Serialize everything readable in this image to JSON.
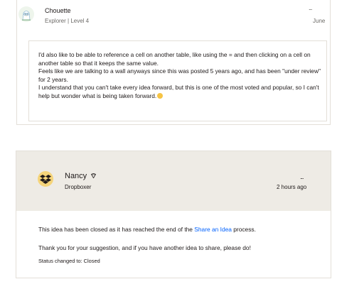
{
  "top_post": {
    "author": "Chouette",
    "rank": "Explorer | Level 4",
    "date": "June",
    "menu": "...",
    "paragraphs": [
      "I'd also like to be able to reference a cell on another table, like using the = and then clicking on a cell on another table so that it keeps the same value.",
      "Feels like we are talking to a wall anyways since this was posted 5 years ago, and has been \"under review\" for 2 years.",
      "I understand that you can't take every idea forward, but this is one of the most voted and popular, so I can't help but wonder what is being taken forward."
    ]
  },
  "staff_post": {
    "author": "Nancy",
    "rank": "Dropboxer",
    "date": "2 hours ago",
    "menu": "...",
    "closed_prefix": "This idea has been closed as it has reached the end of the ",
    "closed_link": "Share an Idea",
    "closed_suffix": " process.",
    "thanks": "Thank you for your suggestion, and if you have another idea to share, please do!",
    "status": "Status changed to: Closed"
  },
  "colors": {
    "accent_link": "#0061fe",
    "header_bg": "#eeebe5",
    "border": "#e3dfd8"
  },
  "icons": {
    "avatar_1": "owl-avatar-icon",
    "avatar_2": "dropbox-avatar-icon",
    "badge": "staff-badge-icon",
    "emoji": "blush-emoji-icon"
  }
}
